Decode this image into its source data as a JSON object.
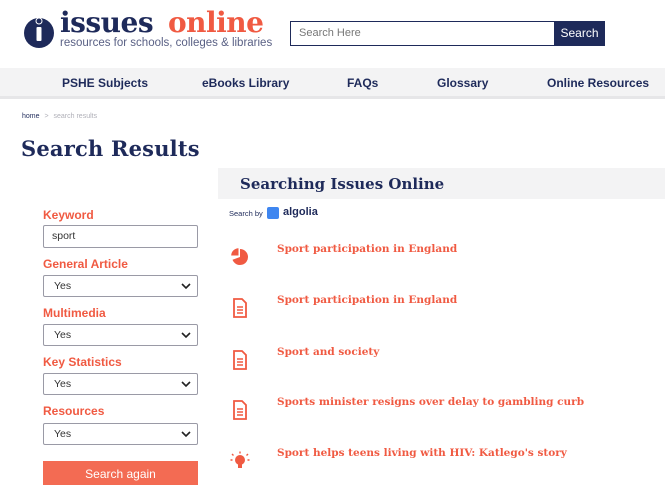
{
  "header": {
    "logo_word1": "issues",
    "logo_word2": "online",
    "tagline": "resources for schools, colleges & libraries",
    "search_placeholder": "Search Here",
    "search_button": "Search"
  },
  "nav": {
    "items": [
      {
        "label": "PSHE Subjects"
      },
      {
        "label": "eBooks Library"
      },
      {
        "label": "FAQs"
      },
      {
        "label": "Glossary"
      },
      {
        "label": "Online Resources"
      }
    ]
  },
  "breadcrumb": {
    "home": "home",
    "separator": ">",
    "current": "search results"
  },
  "page_title": "Search Results",
  "filters": {
    "keyword_label": "Keyword",
    "keyword_value": "sport",
    "general_article_label": "General Article",
    "general_article_value": "Yes",
    "multimedia_label": "Multimedia",
    "multimedia_value": "Yes",
    "key_statistics_label": "Key Statistics",
    "key_statistics_value": "Yes",
    "resources_label": "Resources",
    "resources_value": "Yes",
    "submit_label": "Search again"
  },
  "results": {
    "heading": "Searching Issues Online",
    "search_by": "Search by",
    "provider": "algolia",
    "items": [
      {
        "title": "Sport participation in England",
        "icon": "pie-chart-icon"
      },
      {
        "title": "Sport participation in England",
        "icon": "document-icon"
      },
      {
        "title": "Sport and society",
        "icon": "document-icon"
      },
      {
        "title": "Sports minister resigns over delay to gambling curb",
        "icon": "document-icon"
      },
      {
        "title": "Sport helps teens living with HIV: Katlego's story",
        "icon": "lightbulb-icon"
      }
    ]
  },
  "colors": {
    "navy": "#1e2a5a",
    "coral": "#f05a42",
    "button_coral": "#f36b53",
    "nav_bg": "#f3f3f4",
    "algolia_blue": "#3f86f0"
  }
}
